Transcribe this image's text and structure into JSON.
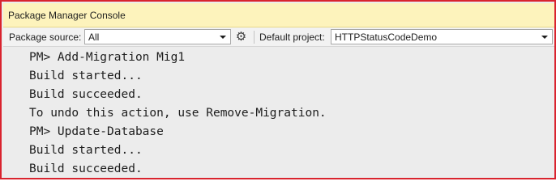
{
  "window": {
    "title": "Package Manager Console"
  },
  "toolbar": {
    "package_source_label": "Package source:",
    "package_source_value": "All",
    "settings_icon": "gear-icon",
    "default_project_label": "Default project:",
    "default_project_value": "HTTPStatusCodeDemo"
  },
  "console": {
    "lines": [
      "PM> Add-Migration Mig1",
      "Build started...",
      "Build succeeded.",
      "To undo this action, use Remove-Migration.",
      "PM> Update-Database",
      "Build started...",
      "Build succeeded."
    ]
  },
  "colors": {
    "border": "#d9232e",
    "titlebar": "#fdf3bc",
    "console_bg": "#ececec"
  }
}
